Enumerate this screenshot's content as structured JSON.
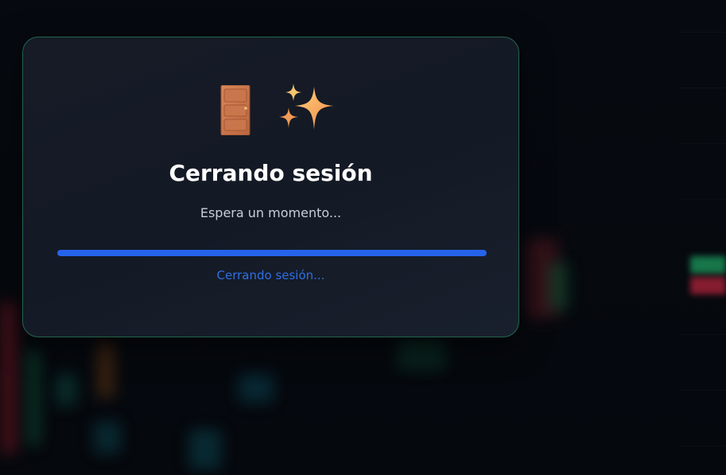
{
  "logout_dialog": {
    "title": "Cerrando sesión",
    "subtitle": "Espera un momento...",
    "status": "Cerrando sesión...",
    "progress_fraction": 1.0,
    "icons": [
      "door-icon",
      "sparkles-icon"
    ]
  },
  "colors": {
    "background": "#05080d",
    "card": "#161b26",
    "card_border": "#2ea06e",
    "accent": "#2563eb",
    "status_text": "#2f6fe4"
  }
}
